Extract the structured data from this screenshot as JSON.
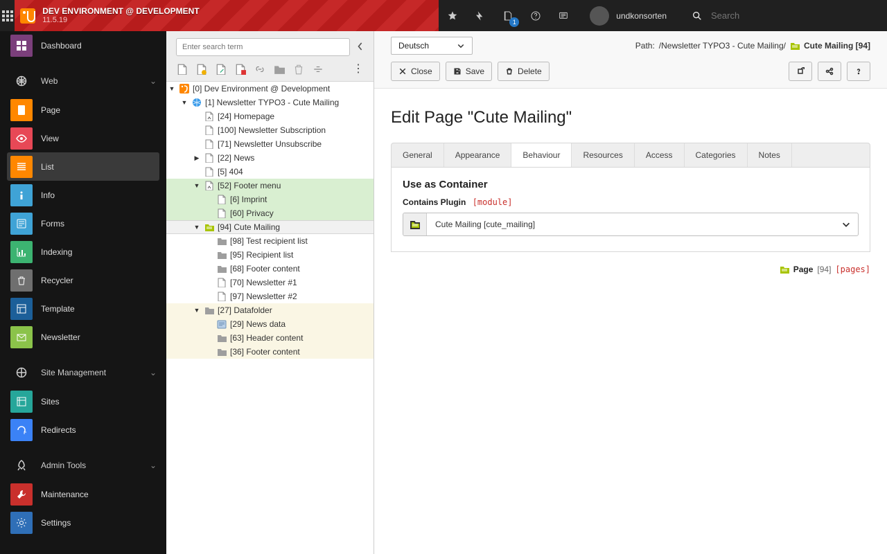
{
  "header": {
    "context_name": "DEV ENVIRONMENT @ DEVELOPMENT",
    "version": "11.5.19",
    "notifications_badge": "1",
    "username": "undkonsorten",
    "search_placeholder": "Search"
  },
  "modules": {
    "dashboard": "Dashboard",
    "groups": [
      {
        "label": "Web",
        "icon": "globe"
      },
      {
        "label": "Site Management",
        "icon": "globe"
      },
      {
        "label": "Admin Tools",
        "icon": "rocket"
      }
    ],
    "web": [
      {
        "label": "Page",
        "color": "#ff8700",
        "icon": "file"
      },
      {
        "label": "View",
        "color": "#e74856",
        "icon": "eye"
      },
      {
        "label": "List",
        "color": "#ff8700",
        "icon": "list",
        "active": true
      },
      {
        "label": "Info",
        "color": "#3fa3d6",
        "icon": "info"
      },
      {
        "label": "Forms",
        "color": "#3fa3d6",
        "icon": "form"
      },
      {
        "label": "Indexing",
        "color": "#3cb371",
        "icon": "chart"
      },
      {
        "label": "Recycler",
        "color": "#6f6f6f",
        "icon": "trash"
      },
      {
        "label": "Template",
        "color": "#1c5f99",
        "icon": "template"
      },
      {
        "label": "Newsletter",
        "color": "#8bc34a",
        "icon": "mail"
      }
    ],
    "site": [
      {
        "label": "Sites",
        "color": "#26a69a",
        "icon": "sites"
      },
      {
        "label": "Redirects",
        "color": "#3b82f6",
        "icon": "redirect"
      }
    ],
    "admin": [
      {
        "label": "Maintenance",
        "color": "#c9302c",
        "icon": "wrench"
      },
      {
        "label": "Settings",
        "color": "#2f6fb7",
        "icon": "gear"
      }
    ]
  },
  "tree": {
    "search_placeholder": "Enter search term",
    "nodes": [
      {
        "depth": 0,
        "arrow": "▼",
        "icon": "typo3",
        "label": "[0] Dev Environment @ Development"
      },
      {
        "depth": 1,
        "arrow": "▼",
        "icon": "globe",
        "label": "[1] Newsletter TYPO3 - Cute Mailing"
      },
      {
        "depth": 2,
        "arrow": "",
        "icon": "page-sc",
        "label": "[24] Homepage"
      },
      {
        "depth": 2,
        "arrow": "",
        "icon": "page",
        "label": "[100] Newsletter Subscription"
      },
      {
        "depth": 2,
        "arrow": "",
        "icon": "page",
        "label": "[71] Newsletter Unsubscribe"
      },
      {
        "depth": 2,
        "arrow": "▶",
        "icon": "page",
        "label": "[22] News"
      },
      {
        "depth": 2,
        "arrow": "",
        "icon": "page",
        "label": "[5] 404"
      },
      {
        "depth": 2,
        "arrow": "▼",
        "icon": "page-sc",
        "label": "[52] Footer menu",
        "hl": "green"
      },
      {
        "depth": 3,
        "arrow": "",
        "icon": "page",
        "label": "[6] Imprint",
        "hl": "green"
      },
      {
        "depth": 3,
        "arrow": "",
        "icon": "page",
        "label": "[60] Privacy",
        "hl": "green"
      },
      {
        "depth": 2,
        "arrow": "▼",
        "icon": "folder-y",
        "label": "[94] Cute Mailing",
        "hl": "sel"
      },
      {
        "depth": 3,
        "arrow": "",
        "icon": "folder",
        "label": "[98] Test recipient list"
      },
      {
        "depth": 3,
        "arrow": "",
        "icon": "folder",
        "label": "[95] Recipient list"
      },
      {
        "depth": 3,
        "arrow": "",
        "icon": "folder",
        "label": "[68] Footer content"
      },
      {
        "depth": 3,
        "arrow": "",
        "icon": "page",
        "label": "[70] Newsletter #1"
      },
      {
        "depth": 3,
        "arrow": "",
        "icon": "page",
        "label": "[97] Newsletter #2"
      },
      {
        "depth": 2,
        "arrow": "▼",
        "icon": "folder",
        "label": "[27] Datafolder",
        "hl": "yellow"
      },
      {
        "depth": 3,
        "arrow": "",
        "icon": "news",
        "label": "[29] News data",
        "hl": "yellow"
      },
      {
        "depth": 3,
        "arrow": "",
        "icon": "folder",
        "label": "[63] Header content",
        "hl": "yellow"
      },
      {
        "depth": 3,
        "arrow": "",
        "icon": "folder",
        "label": "[36] Footer content",
        "hl": "yellow"
      }
    ]
  },
  "content": {
    "language": "Deutsch",
    "path_prefix": "Path: ",
    "path_segments": "/Newsletter TYPO3 - Cute Mailing/",
    "path_current": "Cute Mailing [94]",
    "buttons": {
      "close": "Close",
      "save": "Save",
      "delete": "Delete"
    },
    "title": "Edit Page \"Cute Mailing\"",
    "tabs": [
      "General",
      "Appearance",
      "Behaviour",
      "Resources",
      "Access",
      "Categories",
      "Notes"
    ],
    "active_tab_index": 2,
    "section_title": "Use as Container",
    "field_label": "Contains Plugin",
    "field_badge": "[module]",
    "field_value": "Cute Mailing [cute_mailing]",
    "footer": {
      "entity": "Page",
      "id": "[94]",
      "table": "[pages]"
    }
  }
}
